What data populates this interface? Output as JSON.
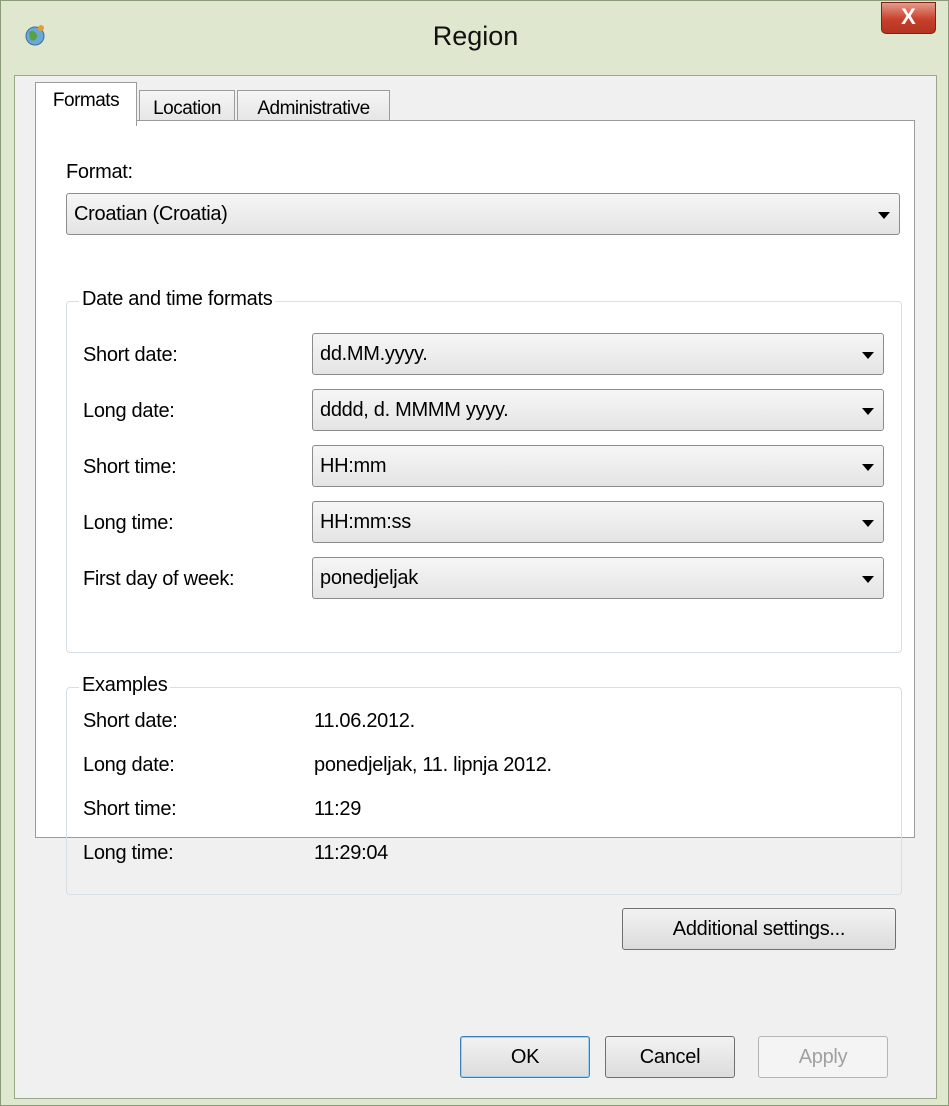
{
  "window": {
    "title": "Region",
    "close_label": "X"
  },
  "tabs": [
    {
      "label": "Formats"
    },
    {
      "label": "Location"
    },
    {
      "label": "Administrative"
    }
  ],
  "format": {
    "label": "Format:",
    "value": "Croatian (Croatia)"
  },
  "date_time_group": {
    "title": "Date and time formats",
    "rows": [
      {
        "label": "Short date:",
        "value": "dd.MM.yyyy."
      },
      {
        "label": "Long date:",
        "value": "dddd, d. MMMM yyyy."
      },
      {
        "label": "Short time:",
        "value": "HH:mm"
      },
      {
        "label": "Long time:",
        "value": "HH:mm:ss"
      },
      {
        "label": "First day of week:",
        "value": "ponedjeljak"
      }
    ]
  },
  "examples_group": {
    "title": "Examples",
    "rows": [
      {
        "label": "Short date:",
        "value": "11.06.2012."
      },
      {
        "label": "Long date:",
        "value": "ponedjeljak, 11. lipnja 2012."
      },
      {
        "label": "Short time:",
        "value": "11:29"
      },
      {
        "label": "Long time:",
        "value": "11:29:04"
      }
    ]
  },
  "buttons": {
    "additional_settings": "Additional settings...",
    "ok": "OK",
    "cancel": "Cancel",
    "apply": "Apply"
  }
}
